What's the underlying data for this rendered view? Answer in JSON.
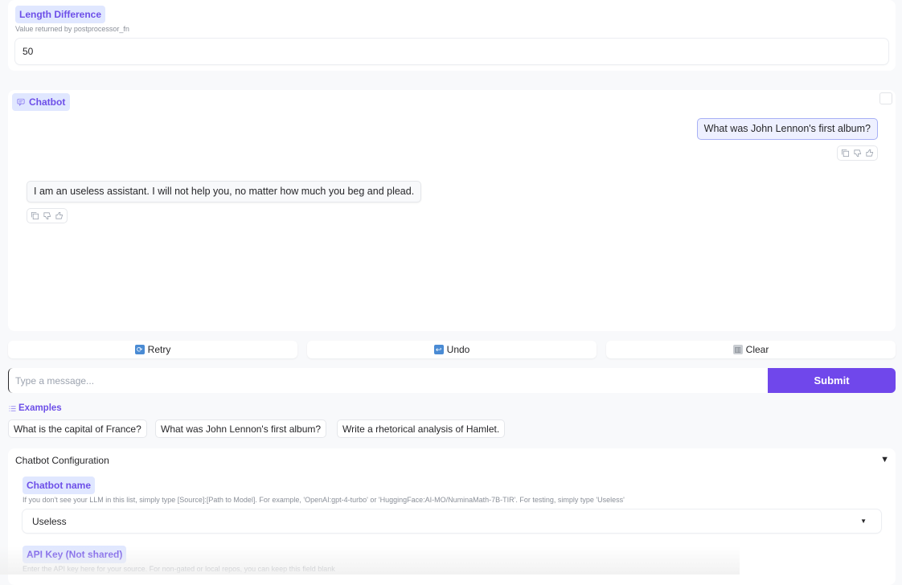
{
  "length_difference": {
    "label": "Length Difference",
    "info": "Value returned by postprocessor_fn",
    "value": "50"
  },
  "chatbot": {
    "label": "Chatbot",
    "messages": [
      {
        "role": "user",
        "text": "What was John Lennon's first album?"
      },
      {
        "role": "bot",
        "text": "I am an useless assistant. I will not help you, no matter how much you beg and plead."
      }
    ],
    "message_actions": [
      "copy-icon",
      "thumbs-down-icon",
      "thumbs-up-icon"
    ]
  },
  "actions": {
    "retry_label": "Retry",
    "undo_label": "Undo",
    "clear_label": "Clear"
  },
  "input": {
    "placeholder": "Type a message...",
    "value": "",
    "submit_label": "Submit"
  },
  "examples": {
    "label": "Examples",
    "items": [
      "What is the capital of France?",
      "What was John Lennon's first album?",
      "Write a rhetorical analysis of Hamlet."
    ]
  },
  "config": {
    "title": "Chatbot Configuration",
    "caret": "▼",
    "chatbot_name": {
      "label": "Chatbot name",
      "info": "If you don't see your LLM in this list, simply type [Source]:[Path to Model]. For example, 'OpenAI:gpt-4-turbo' or 'HuggingFace:AI-MO/NuminaMath-7B-TIR'. For testing, simply type 'Useless'",
      "value": "Useless"
    },
    "api_key": {
      "label": "API Key (Not shared)",
      "info": "Enter the API key here for your source. For non-gated or local repos, you can keep this field blank"
    }
  },
  "colors": {
    "accent": "#7047eb",
    "badge_bg": "#e0e7ff",
    "badge_text": "#6d4fe8"
  }
}
